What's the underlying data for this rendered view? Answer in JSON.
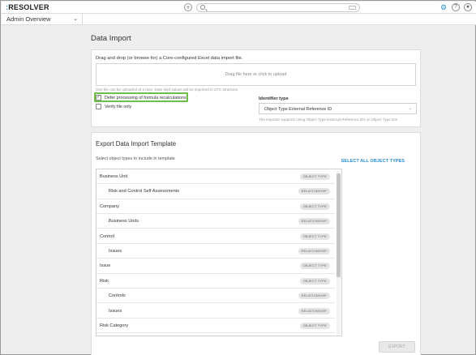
{
  "topbar": {
    "logo_prefix": ":",
    "logo_text": "RESOLVER",
    "search_placeholder": "",
    "icons": [
      "plus-circle-icon",
      "search-icon",
      "gear-icon",
      "help-icon",
      "user-icon"
    ],
    "accent_color": "#2b8fd6"
  },
  "nav": {
    "current": "Admin Overview"
  },
  "page": {
    "title": "Data Import"
  },
  "import": {
    "drag_text": "Drag and drop (or browse for) a Core-configured Excel data import file.",
    "dropzone_text": "Drag file here or click to upload",
    "hint": "One file can be uploaded at a time. Date field values will be imported in UTC timezone.",
    "defer_label": "Defer processing of formula recalculations",
    "defer_checked": true,
    "verify_label": "Verify file only",
    "verify_checked": false,
    "identifier_label": "Identifier type",
    "identifier_value": "Object Type External Reference ID",
    "identifier_note": "The importer supports using Object Type External Reference IDs or Object Type IDs",
    "highlight_color": "#6cc04a"
  },
  "export": {
    "title": "Export Data Import Template",
    "select_label": "Select object types to include in template",
    "select_all": "SELECT ALL OBJECT TYPES",
    "button": "EXPORT",
    "rows": [
      {
        "name": "Business Unit",
        "badge": "OBJECT TYPE",
        "indent": false
      },
      {
        "name": "Risk and Control Self Assessments",
        "badge": "RELATIONSHIP",
        "indent": true
      },
      {
        "name": "Company",
        "badge": "OBJECT TYPE",
        "indent": false
      },
      {
        "name": "Business Units",
        "badge": "RELATIONSHIP",
        "indent": true
      },
      {
        "name": "Control",
        "badge": "OBJECT TYPE",
        "indent": false
      },
      {
        "name": "Issues",
        "badge": "RELATIONSHIP",
        "indent": true
      },
      {
        "name": "Issue",
        "badge": "OBJECT TYPE",
        "indent": false
      },
      {
        "name": "Risk",
        "badge": "OBJECT TYPE",
        "indent": false
      },
      {
        "name": "Controls",
        "badge": "RELATIONSHIP",
        "indent": true
      },
      {
        "name": "Issues",
        "badge": "RELATIONSHIP",
        "indent": true
      },
      {
        "name": "Risk Category",
        "badge": "OBJECT TYPE",
        "indent": false
      }
    ]
  }
}
